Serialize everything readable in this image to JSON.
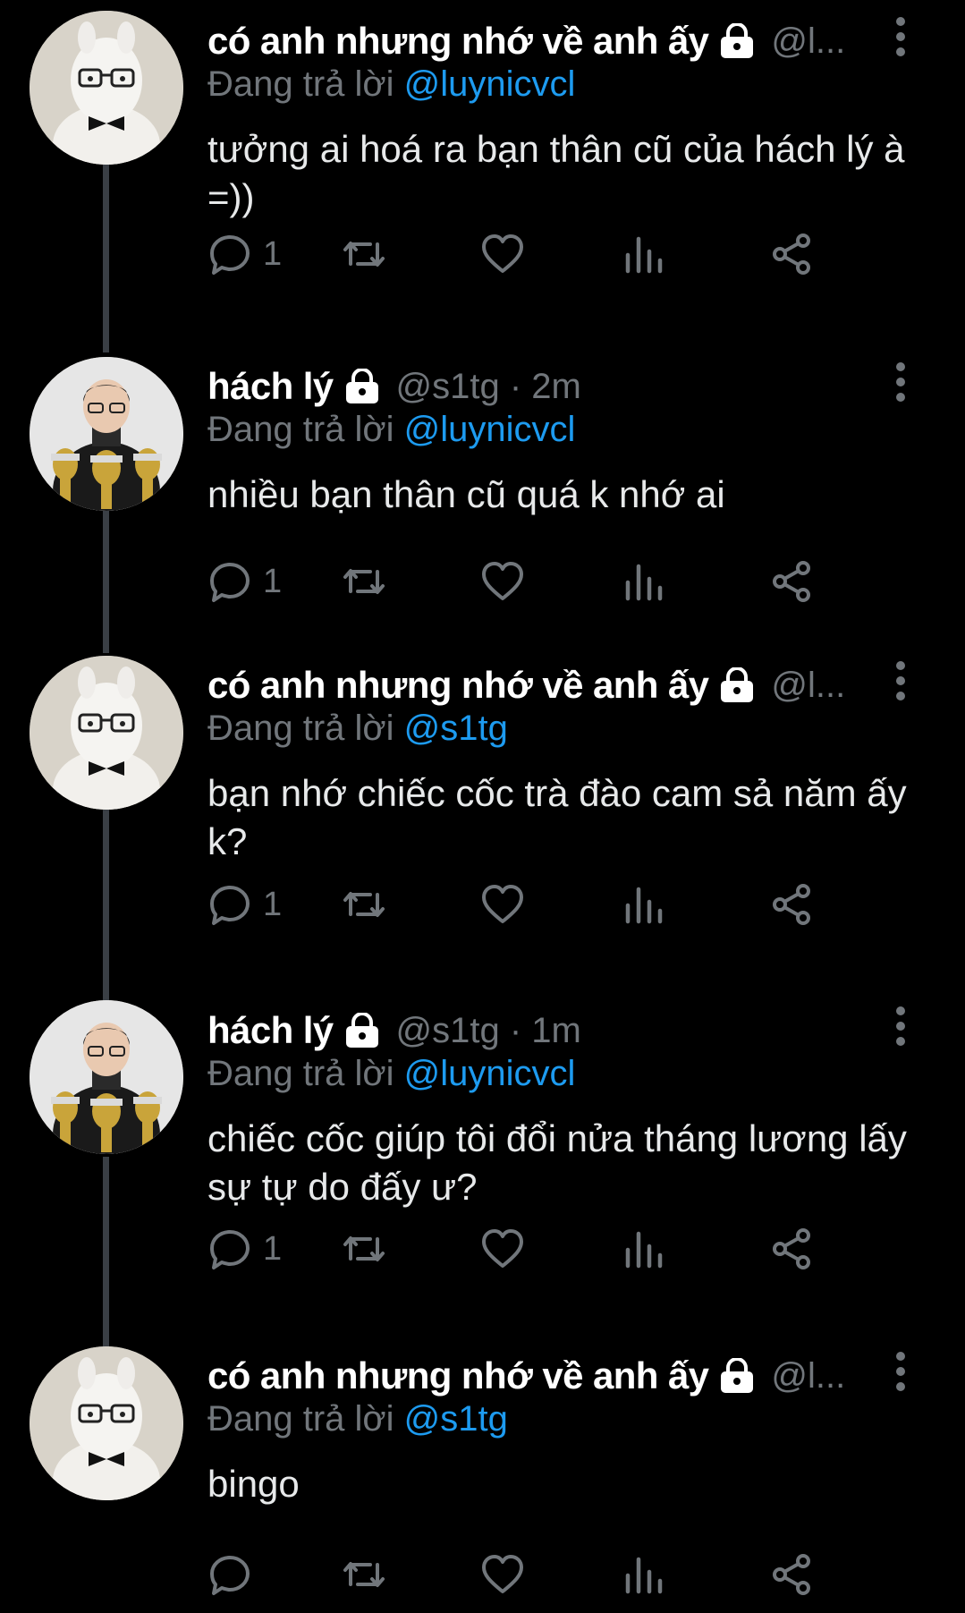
{
  "thread": {
    "tweets": [
      {
        "avatar": "alpaca-plush-avatar",
        "display_name": "có anh nhưng nhớ về anh ấy",
        "handle": "@l...",
        "reply_prefix": "Đang trả lời ",
        "reply_to": "@luynicvcl",
        "text": "tưởng ai hoá ra bạn thân cũ của hách lý à =))",
        "reply_count": "1"
      },
      {
        "avatar": "person-with-trophies-avatar",
        "display_name": "hách lý",
        "handle": "@s1tg · 2m",
        "reply_prefix": "Đang trả lời ",
        "reply_to": "@luynicvcl",
        "text": "nhiều bạn thân cũ quá k nhớ ai",
        "reply_count": "1"
      },
      {
        "avatar": "alpaca-plush-avatar",
        "display_name": "có anh nhưng nhớ về anh ấy",
        "handle": "@l...",
        "reply_prefix": "Đang trả lời ",
        "reply_to": "@s1tg",
        "text": "bạn nhớ chiếc cốc trà đào cam sả năm ấy k?",
        "reply_count": "1"
      },
      {
        "avatar": "person-with-trophies-avatar",
        "display_name": "hách lý",
        "handle": "@s1tg · 1m",
        "reply_prefix": "Đang trả lời ",
        "reply_to": "@luynicvcl",
        "text": "chiếc cốc giúp tôi đổi nửa tháng lương lấy sự tự do đấy ư?",
        "reply_count": "1"
      },
      {
        "avatar": "alpaca-plush-avatar",
        "display_name": "có anh nhưng nhớ về anh ấy",
        "handle": "@l...",
        "reply_prefix": "Đang trả lời ",
        "reply_to": "@s1tg",
        "text": "bingo",
        "reply_count": ""
      }
    ]
  },
  "icons": {
    "reply": "reply-icon",
    "retweet": "retweet-icon",
    "like": "like-icon",
    "views": "views-icon",
    "share": "share-icon",
    "protected": "lock-icon",
    "more": "more-icon"
  },
  "colors": {
    "background": "#000000",
    "text": "#e7e9ea",
    "secondary": "#71767b",
    "mention": "#1d9bf0",
    "thread_line": "#3a3f45"
  }
}
